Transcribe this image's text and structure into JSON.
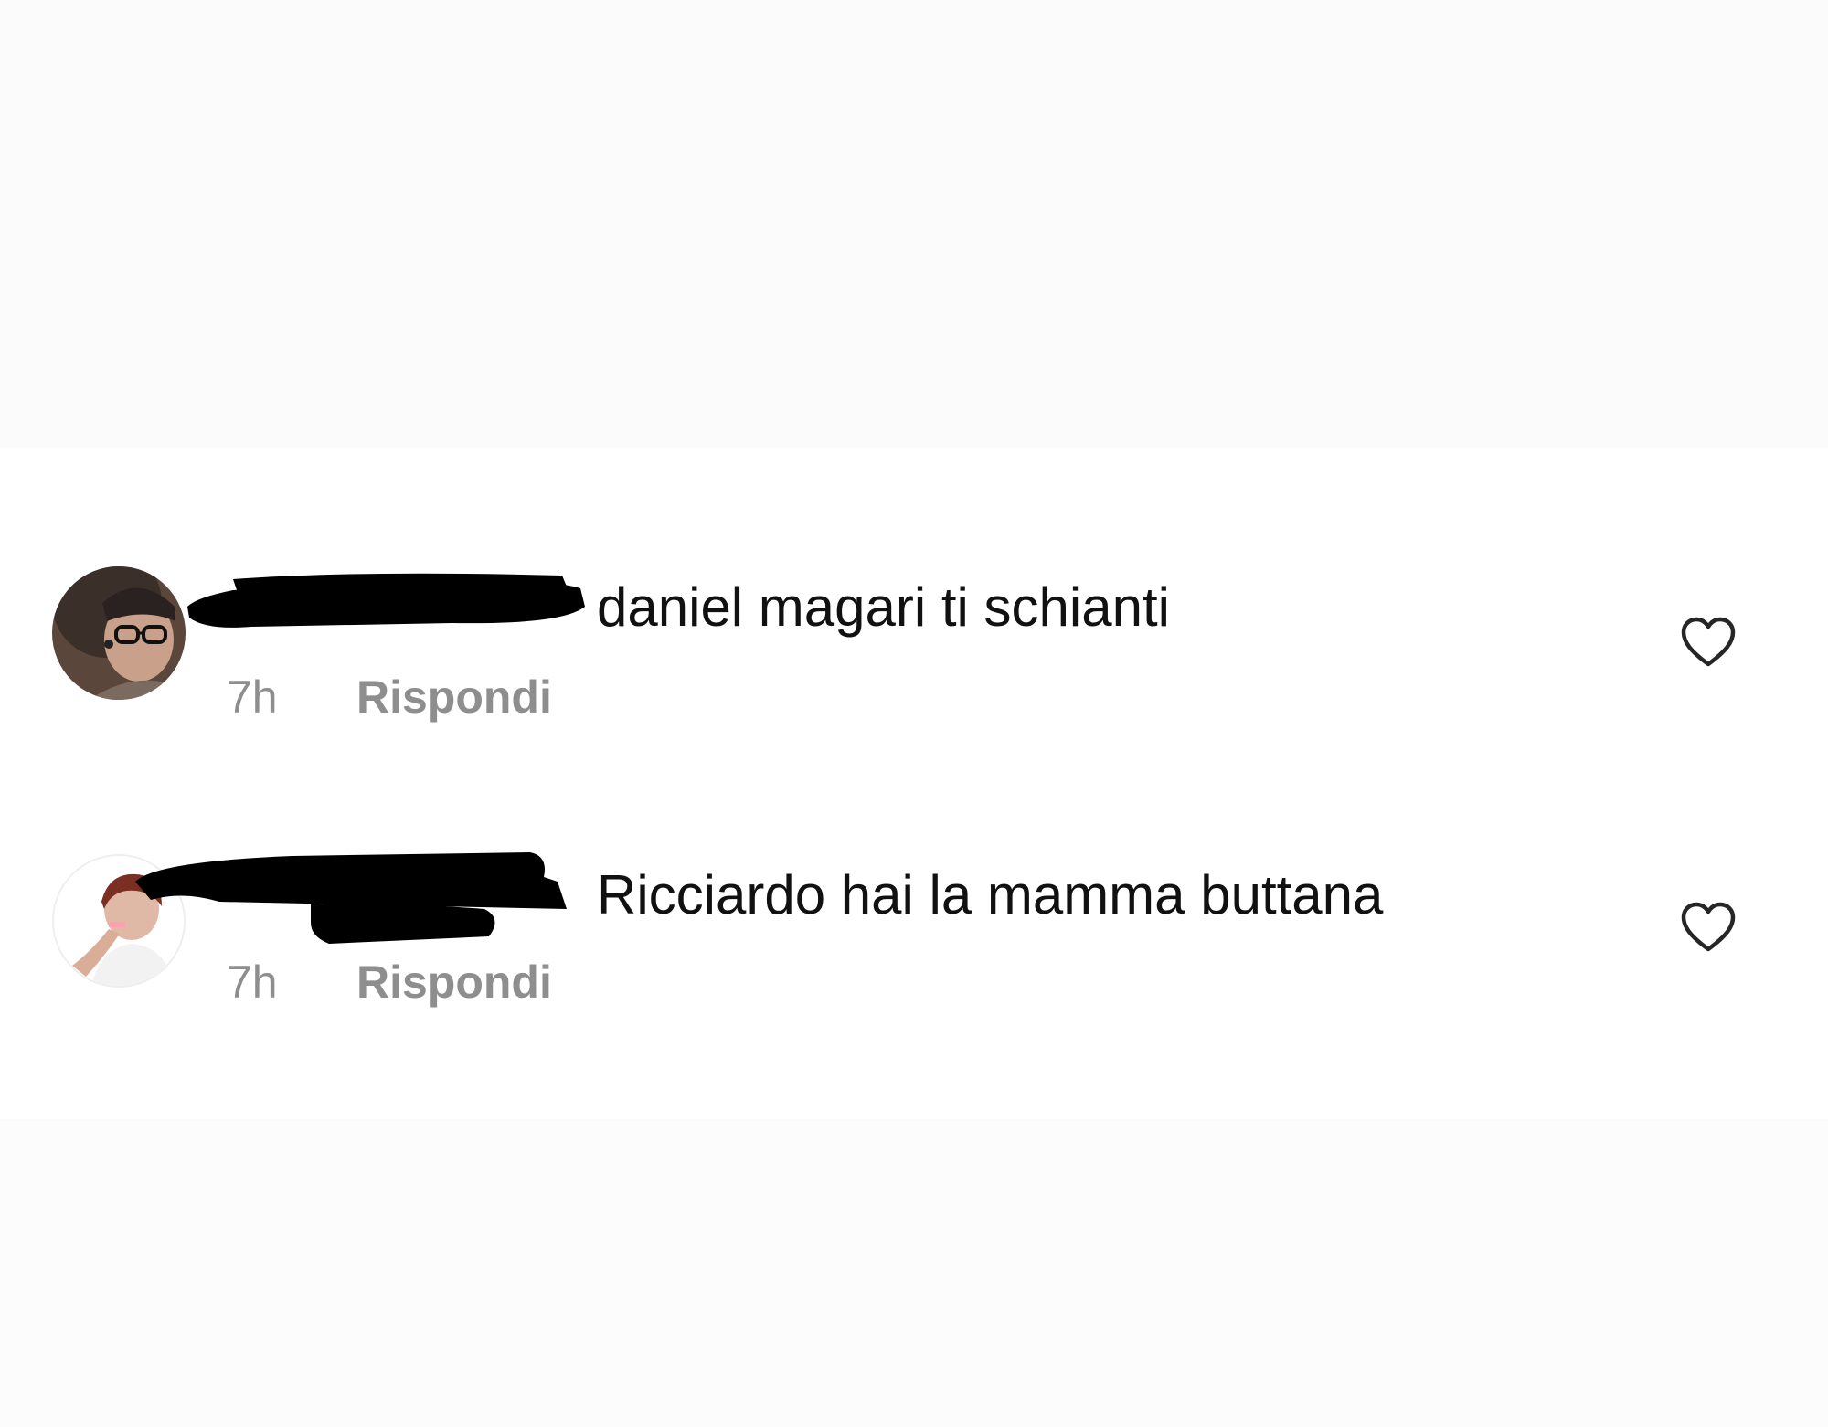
{
  "comments": [
    {
      "text": "daniel magari ti schianti",
      "time": "7h",
      "reply_label": "Rispondi",
      "like_icon": "heart-outline-icon"
    },
    {
      "text": "Ricciardo hai la mamma buttana",
      "time": "7h",
      "reply_label": "Rispondi",
      "like_icon": "heart-outline-icon"
    }
  ],
  "colors": {
    "text_primary": "#111111",
    "text_secondary": "#8e8e8e",
    "redaction": "#000000"
  }
}
